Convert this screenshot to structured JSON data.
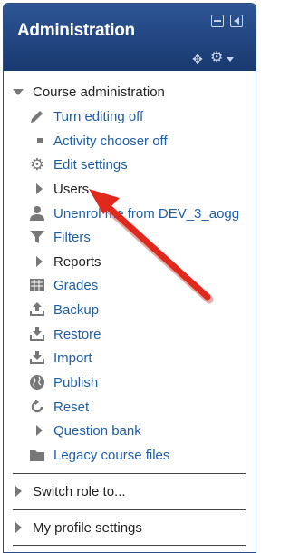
{
  "block": {
    "title": "Administration",
    "icons": [
      "hide-block-icon",
      "dock-block-icon",
      "move-icon",
      "gear-icon",
      "caret-down-icon"
    ]
  },
  "course_admin": {
    "heading": "Course administration",
    "items": [
      {
        "label": "Turn editing off",
        "icon": "pencil-icon"
      },
      {
        "label": "Activity chooser off",
        "icon": "square-bullet-icon"
      },
      {
        "label": "Edit settings",
        "icon": "gear-icon"
      },
      {
        "label": "Users",
        "icon": "expand-triangle-icon"
      },
      {
        "label": "Unenrol me from DEV_3_aogg",
        "icon": "user-icon"
      },
      {
        "label": "Filters",
        "icon": "filter-icon"
      },
      {
        "label": "Reports",
        "icon": "expand-triangle-icon"
      },
      {
        "label": "Grades",
        "icon": "grades-table-icon"
      },
      {
        "label": "Backup",
        "icon": "backup-upload-icon"
      },
      {
        "label": "Restore",
        "icon": "restore-download-icon"
      },
      {
        "label": "Import",
        "icon": "import-download-icon"
      },
      {
        "label": "Publish",
        "icon": "globe-icon"
      },
      {
        "label": "Reset",
        "icon": "reset-circular-arrow-icon"
      },
      {
        "label": "Question bank",
        "icon": "expand-triangle-icon"
      },
      {
        "label": "Legacy course files",
        "icon": "folder-icon"
      }
    ]
  },
  "sections": [
    {
      "label": "Switch role to..."
    },
    {
      "label": "My profile settings"
    }
  ],
  "colors": {
    "header": "#1f437d",
    "link": "#1e5ea6",
    "annotation_arrow": "#e0281c"
  }
}
